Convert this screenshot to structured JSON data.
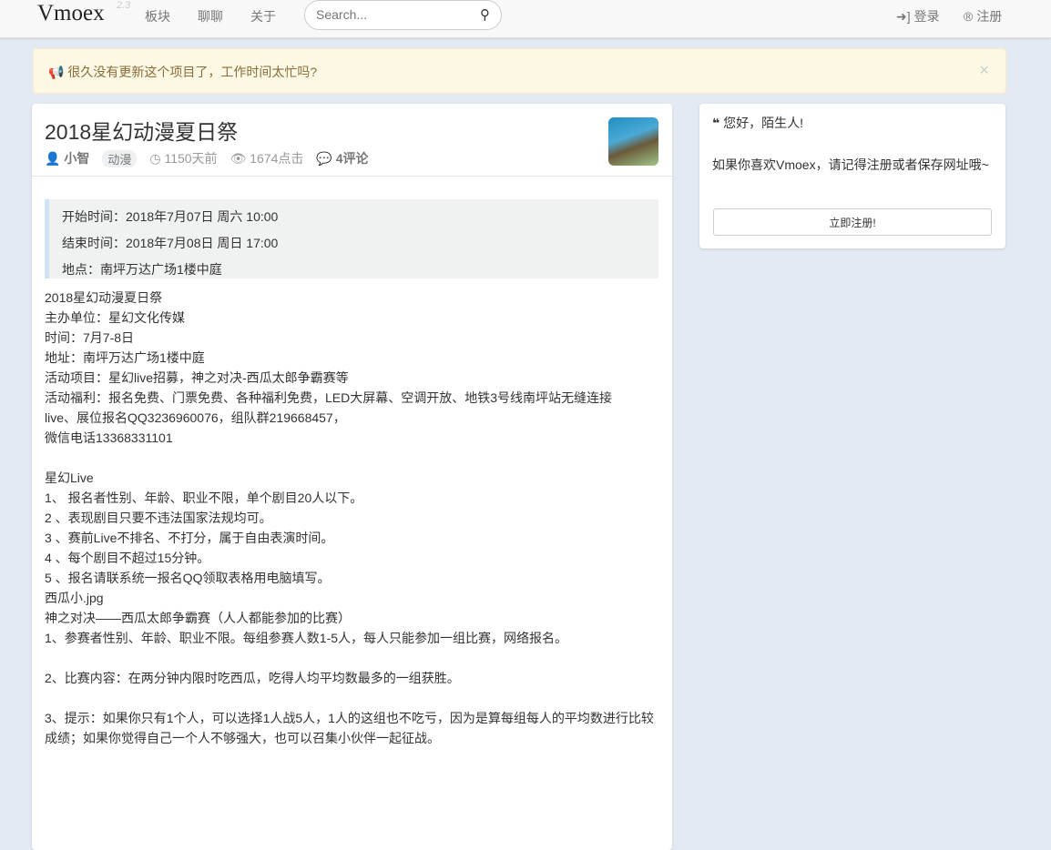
{
  "nav": {
    "brand": "Vmoex",
    "version": "2.3",
    "links": [
      "板块",
      "聊聊",
      "关于"
    ],
    "search_placeholder": "Search...",
    "login": "登录",
    "register": "注册"
  },
  "alert": {
    "text": "很久没有更新这个项目了，工作时间太忙吗?",
    "close": "×"
  },
  "post": {
    "title": "2018星幻动漫夏日祭",
    "author": "小智",
    "tag": "动漫",
    "time": "1150天前",
    "views": "1674点击",
    "comments": "4评论",
    "info": [
      "开始时间：2018年7月07日 周六 10:00",
      "结束时间：2018年7月08日 周日 17:00",
      "地点：南坪万达广场1楼中庭"
    ],
    "body": "2018星幻动漫夏日祭\n主办单位：星幻文化传媒\n时间：7月7-8日\n地址：南坪万达广场1楼中庭\n活动项目：星幻live招募，神之对决-西瓜太郎争霸赛等\n活动福利：报名免费、门票免费、各种福利免费，LED大屏幕、空调开放、地铁3号线南坪站无缝连接\nlive、展位报名QQ3236960076，组队群219668457，\n微信电话13368331101\n\n星幻Live\n1、 报名者性别、年龄、职业不限，单个剧目20人以下。\n2 、表现剧目只要不违法国家法规均可。\n3 、赛前Live不排名、不打分，属于自由表演时间。\n4 、每个剧目不超过15分钟。\n5 、报名请联系统一报名QQ领取表格用电脑填写。\n西瓜小.jpg\n神之对决——西瓜太郎争霸赛（人人都能参加的比赛）\n1、参赛者性别、年龄、职业不限。每组参赛人数1-5人，每人只能参加一组比赛，网络报名。\n\n2、比赛内容：在两分钟内限时吃西瓜，吃得人均平均数最多的一组获胜。\n\n3、提示：如果你只有1个人，可以选择1人战5人，1人的这组也不吃亏，因为是算每组每人的平均数进行比较成绩；如果你觉得自己一个人不够强大，也可以召集小伙伴一起征战。"
  },
  "sidebar": {
    "greeting": "您好，陌生人!",
    "text": "如果你喜欢Vmoex，请记得注册或者保存网址哦~",
    "button": "立即注册!"
  }
}
